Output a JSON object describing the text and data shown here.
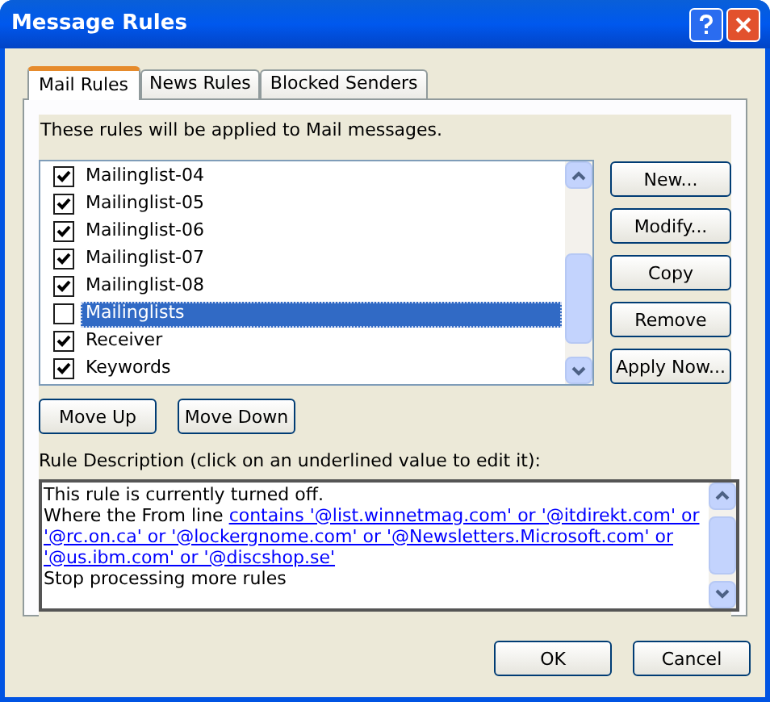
{
  "window": {
    "title": "Message Rules"
  },
  "tabs": [
    {
      "label": "Mail Rules",
      "selected": true
    },
    {
      "label": "News Rules",
      "selected": false
    },
    {
      "label": "Blocked Senders",
      "selected": false
    }
  ],
  "info": "These rules will be applied to Mail messages.",
  "rules": [
    {
      "name": "Mailinglist-04",
      "checked": true,
      "selected": false
    },
    {
      "name": "Mailinglist-05",
      "checked": true,
      "selected": false
    },
    {
      "name": "Mailinglist-06",
      "checked": true,
      "selected": false
    },
    {
      "name": "Mailinglist-07",
      "checked": true,
      "selected": false
    },
    {
      "name": "Mailinglist-08",
      "checked": true,
      "selected": false
    },
    {
      "name": "Mailinglists",
      "checked": false,
      "selected": true
    },
    {
      "name": "Receiver",
      "checked": true,
      "selected": false
    },
    {
      "name": "Keywords",
      "checked": true,
      "selected": false
    }
  ],
  "side_buttons": [
    "New...",
    "Modify...",
    "Copy",
    "Remove",
    "Apply Now..."
  ],
  "move_buttons": [
    "Move Up",
    "Move Down"
  ],
  "description_label": "Rule Description (click on an underlined value to edit it):",
  "description_lines": [
    {
      "text": "This rule is currently turned off."
    },
    {
      "text": "Where the From line ",
      "link": "contains '@list.winnetmag.com' or '@itdirekt.com' or"
    },
    {
      "link": "'@rc.on.ca' or '@lockergnome.com' or '@Newsletters.Microsoft.com' or"
    },
    {
      "link": "'@us.ibm.com' or '@discshop.se'"
    },
    {
      "text": "Stop processing more rules"
    }
  ],
  "dialog_buttons": [
    "OK",
    "Cancel"
  ]
}
